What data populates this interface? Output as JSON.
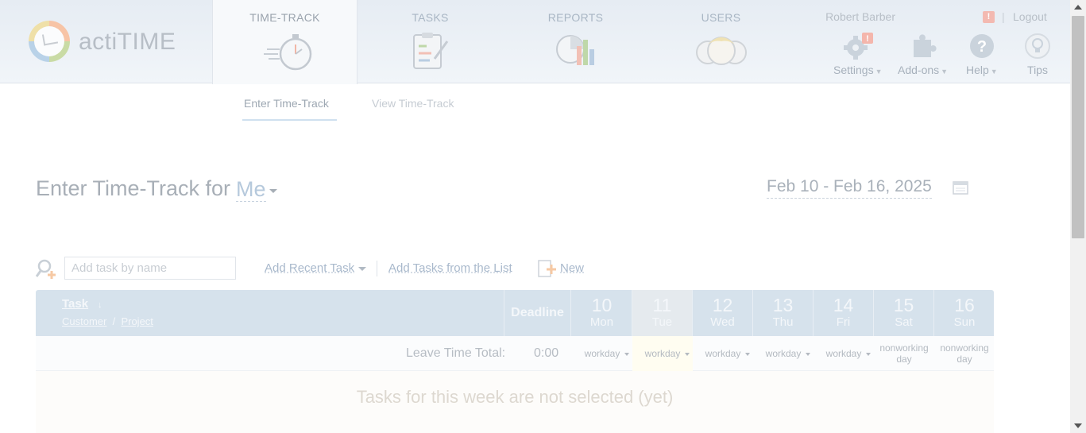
{
  "app": {
    "logo_text": "actiTIME"
  },
  "nav": {
    "tabs": [
      {
        "label": "TIME-TRACK",
        "active": true
      },
      {
        "label": "TASKS",
        "active": false
      },
      {
        "label": "REPORTS",
        "active": false
      },
      {
        "label": "USERS",
        "active": false
      }
    ]
  },
  "user_bar": {
    "username": "Robert Barber",
    "alert_badge": "!",
    "separator": "|",
    "logout_label": "Logout"
  },
  "tools": [
    {
      "label": "Settings",
      "icon": "gear-icon",
      "has_dropdown": true,
      "badge": "!"
    },
    {
      "label": "Add-ons",
      "icon": "puzzle-icon",
      "has_dropdown": true
    },
    {
      "label": "Help",
      "icon": "question-icon",
      "has_dropdown": true
    },
    {
      "label": "Tips",
      "icon": "lightbulb-icon",
      "has_dropdown": false
    }
  ],
  "subnav": {
    "enter_label": "Enter Time-Track",
    "view_label": "View Time-Track"
  },
  "page": {
    "title": "Enter Time-Track for",
    "user_selector": "Me",
    "date_range": "Feb 10 - Feb 16, 2025"
  },
  "toolbar": {
    "search_placeholder": "Add task by name",
    "add_recent_label": "Add Recent Task",
    "add_from_list_label": "Add Tasks from the List",
    "new_label": "New"
  },
  "table": {
    "task_header": "Task",
    "sort_arrow": "↓",
    "customer_header": "Customer",
    "header_separator": "/",
    "project_header": "Project",
    "deadline_header": "Deadline",
    "days": [
      {
        "num": "10",
        "name": "Mon",
        "today": false
      },
      {
        "num": "11",
        "name": "Tue",
        "today": true
      },
      {
        "num": "12",
        "name": "Wed",
        "today": false
      },
      {
        "num": "13",
        "name": "Thu",
        "today": false
      },
      {
        "num": "14",
        "name": "Fri",
        "today": false
      },
      {
        "num": "15",
        "name": "Sat",
        "today": false
      },
      {
        "num": "16",
        "name": "Sun",
        "today": false
      }
    ],
    "leave_label": "Leave Time Total:",
    "leave_total": "0:00",
    "day_types": [
      "workday",
      "workday",
      "workday",
      "workday",
      "workday",
      "nonworking day",
      "nonworking day"
    ],
    "empty_message": "Tasks for this week are not selected (yet)"
  },
  "colors": {
    "header_bg": "#e6ecf3",
    "table_header_bg": "#d6e2ec",
    "today_highlight": "#fffdf1"
  }
}
